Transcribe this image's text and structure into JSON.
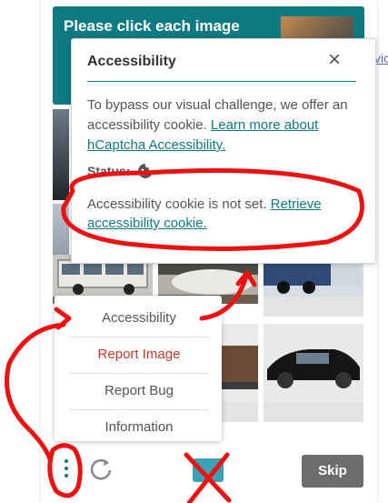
{
  "challenge": {
    "prompt": "Please click each image"
  },
  "side_link": {
    "text": "vic"
  },
  "accessibility_popup": {
    "title": "Accessibility",
    "close_label": "×",
    "intro_text": "To bypass our visual challenge, we offer an accessibility cookie.",
    "learn_more_link": "Learn more about hCaptcha Accessibility.",
    "status_label": "Status:",
    "cookie_status_text": "Accessibility cookie is not set.",
    "retrieve_link": "Retrieve accessibility cookie."
  },
  "menu": {
    "items": [
      {
        "label": "Accessibility",
        "color": "#555555"
      },
      {
        "label": "Report Image",
        "color": "#c0392b"
      },
      {
        "label": "Report Bug",
        "color": "#555555"
      },
      {
        "label": "Information",
        "color": "#555555"
      }
    ]
  },
  "footer": {
    "skip_label": "Skip"
  },
  "colors": {
    "teal": "#0f7a82",
    "annotation_red": "#ee1111"
  }
}
